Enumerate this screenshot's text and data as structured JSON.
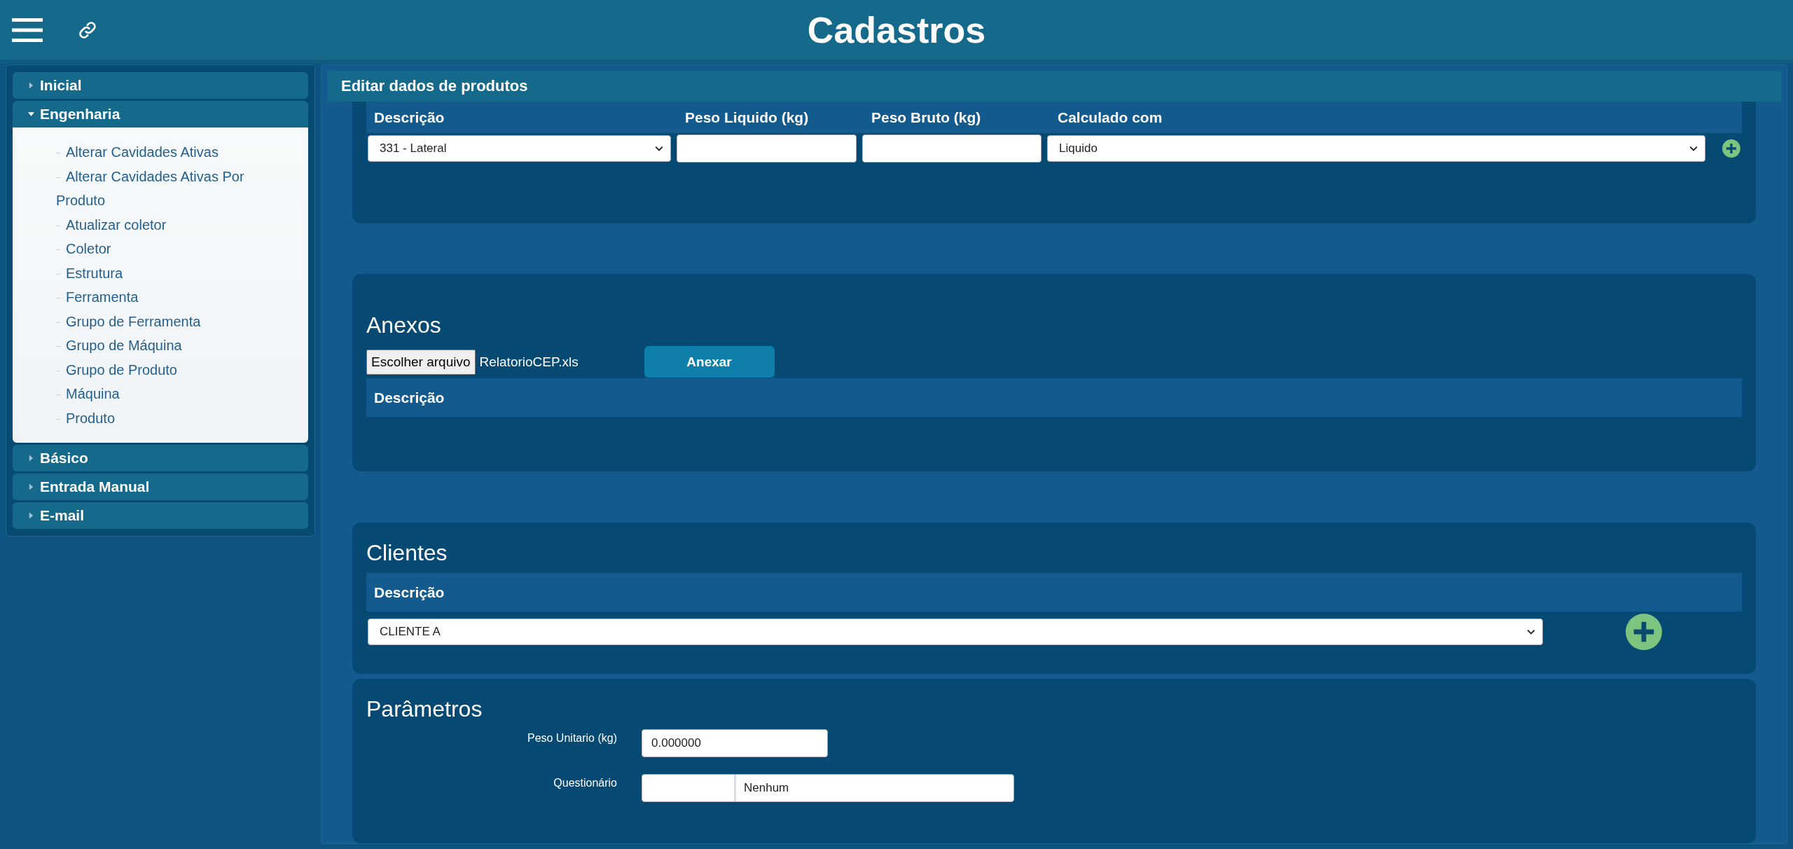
{
  "header": {
    "title": "Cadastros"
  },
  "sidebar": {
    "sections": [
      {
        "label": "Inicial",
        "expanded": false
      },
      {
        "label": "Engenharia",
        "expanded": true,
        "items": [
          "Alterar Cavidades Ativas",
          "Alterar Cavidades Ativas Por Produto",
          "Atualizar coletor",
          "Coletor",
          "Estrutura",
          "Ferramenta",
          "Grupo de Ferramenta",
          "Grupo de Máquina",
          "Grupo de Produto",
          "Máquina",
          "Produto"
        ]
      },
      {
        "label": "Básico",
        "expanded": false
      },
      {
        "label": "Entrada Manual",
        "expanded": false
      },
      {
        "label": "E-mail",
        "expanded": false
      }
    ]
  },
  "panel": {
    "title": "Editar dados de produtos"
  },
  "weights": {
    "columns": [
      "Descrição",
      "Peso Liquido (kg)",
      "Peso Bruto (kg)",
      "Calculado com"
    ],
    "rows": [
      {
        "descricao": "331 - Lateral",
        "peso_liquido": "",
        "peso_bruto": "",
        "calculado_com": "Liquido"
      }
    ]
  },
  "anexos": {
    "title": "Anexos",
    "file_button": "Escolher arquivo",
    "file_name": "RelatorioCEP.xls",
    "attach_button": "Anexar",
    "columns": [
      "Descrição"
    ]
  },
  "clientes": {
    "title": "Clientes",
    "columns": [
      "Descrição"
    ],
    "selected_client": "CLIENTE A"
  },
  "parametros": {
    "title": "Parâmetros",
    "fields": [
      {
        "kind": "text",
        "label": "Peso Unitario (kg)",
        "value": "0.000000"
      },
      {
        "kind": "lookup",
        "label": "Questionário",
        "value": "Nenhum"
      }
    ]
  }
}
